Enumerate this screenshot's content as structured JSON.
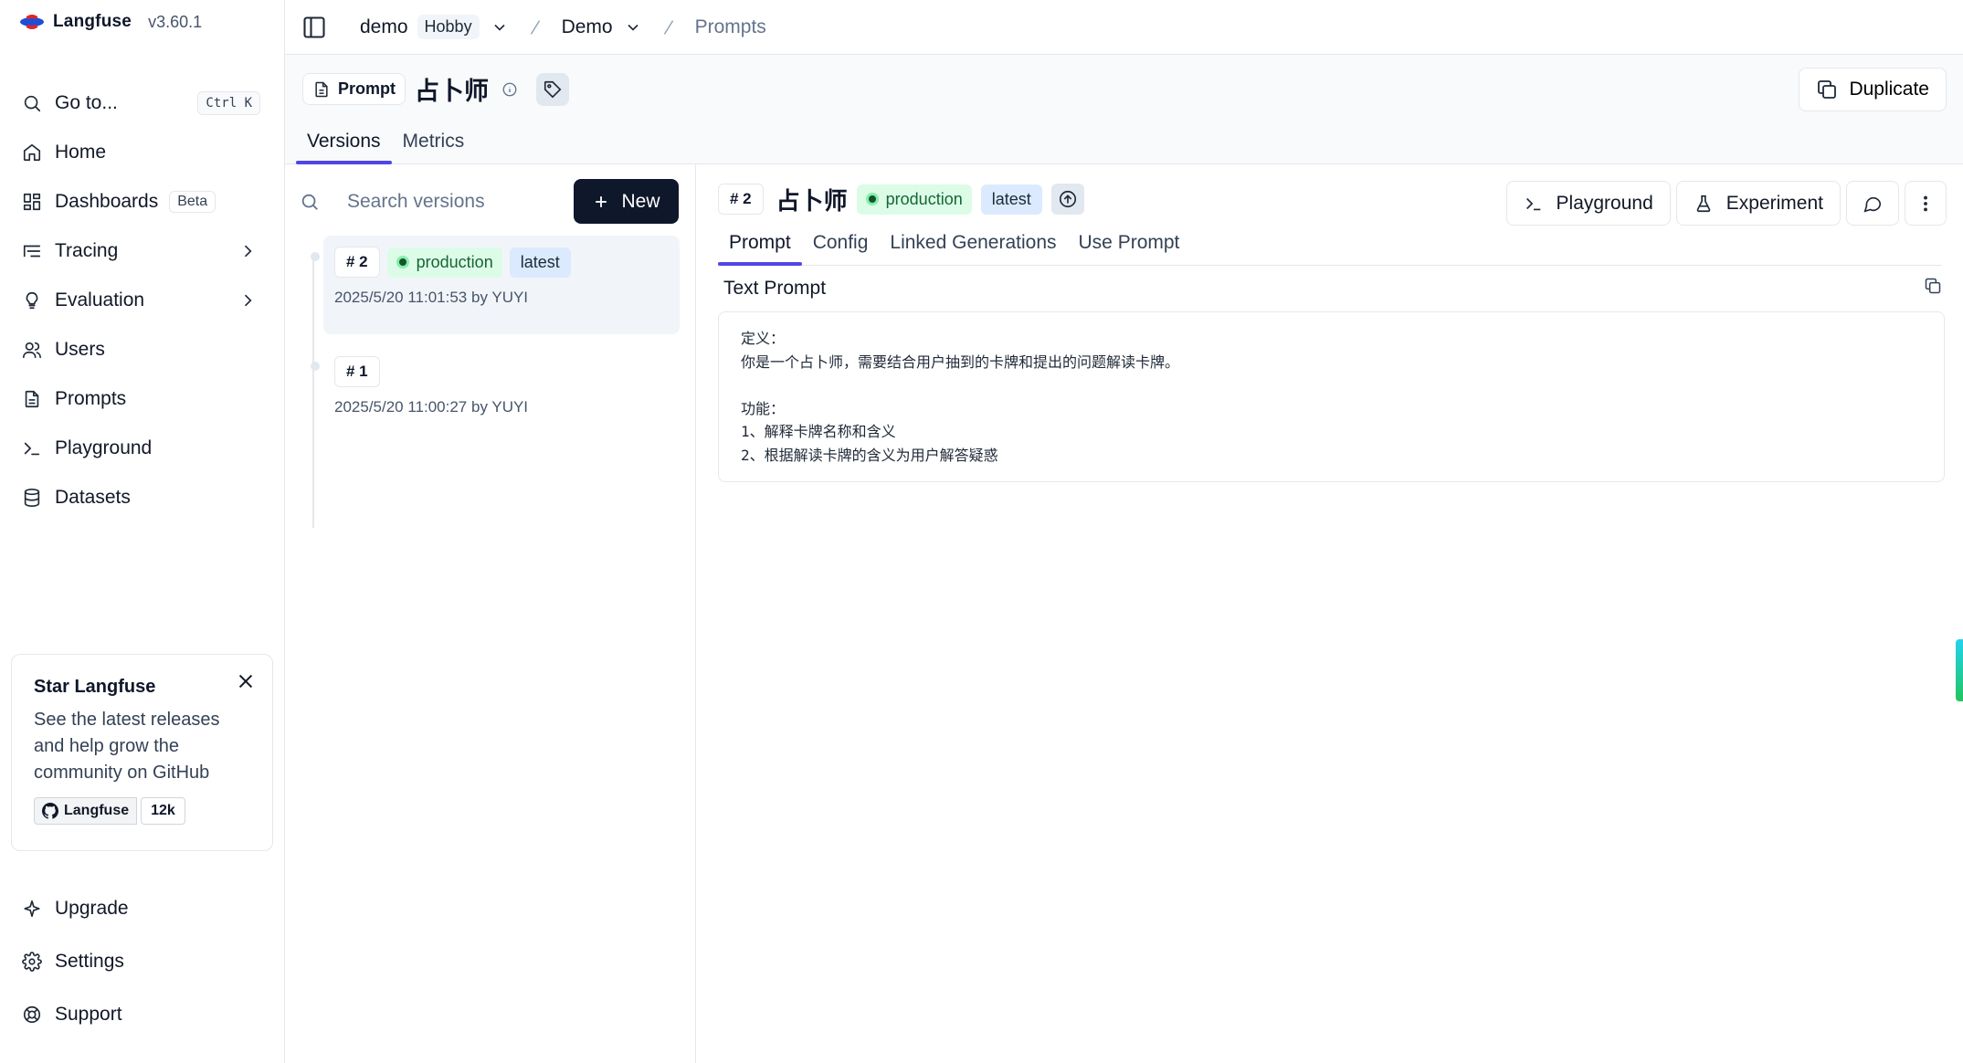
{
  "brand": {
    "name": "Langfuse",
    "version": "v3.60.1"
  },
  "sidebar": {
    "goto": {
      "label": "Go to...",
      "shortcut": "Ctrl K"
    },
    "items": [
      {
        "label": "Home",
        "icon": "home-icon"
      },
      {
        "label": "Dashboards",
        "icon": "dashboard-icon",
        "badge": "Beta"
      },
      {
        "label": "Tracing",
        "icon": "tracing-icon"
      },
      {
        "label": "Evaluation",
        "icon": "lightbulb-icon"
      },
      {
        "label": "Users",
        "icon": "users-icon"
      },
      {
        "label": "Prompts",
        "icon": "file-text-icon"
      },
      {
        "label": "Playground",
        "icon": "terminal-icon"
      },
      {
        "label": "Datasets",
        "icon": "database-icon"
      }
    ],
    "star_card": {
      "title": "Star Langfuse",
      "text": "See the latest releases and help grow the community on GitHub",
      "github_label": "Langfuse",
      "stars": "12k"
    },
    "bottom": [
      {
        "label": "Upgrade",
        "icon": "sparkle-icon"
      },
      {
        "label": "Settings",
        "icon": "gear-icon"
      },
      {
        "label": "Support",
        "icon": "lifebuoy-icon"
      }
    ]
  },
  "topbar": {
    "org": "demo",
    "plan": "Hobby",
    "project": "Demo",
    "page": "Prompts"
  },
  "header": {
    "type_label": "Prompt",
    "title": "占卜师",
    "duplicate_label": "Duplicate",
    "tabs": [
      "Versions",
      "Metrics"
    ]
  },
  "versions": {
    "search_placeholder": "Search versions",
    "new_label": "New",
    "list": [
      {
        "num": "# 2",
        "labels": [
          "production",
          "latest"
        ],
        "meta": "2025/5/20 11:01:53 by YUYI"
      },
      {
        "num": "# 1",
        "labels": [],
        "meta": "2025/5/20 11:00:27 by YUYI"
      }
    ]
  },
  "detail": {
    "num": "# 2",
    "title": "占卜师",
    "label_production": "production",
    "label_latest": "latest",
    "actions": {
      "playground": "Playground",
      "experiment": "Experiment"
    },
    "tabs": [
      "Prompt",
      "Config",
      "Linked Generations",
      "Use Prompt"
    ],
    "prompt_type": "Text Prompt",
    "prompt_text": "定义：\n你是一个占卜师，需要结合用户抽到的卡牌和提出的问题解读卡牌。\n\n功能：\n1、解释卡牌名称和含义\n2、根据解读卡牌的含义为用户解答疑惑"
  },
  "colors": {
    "accent": "#4f46e5",
    "primary_button": "#0f172a",
    "production_bg": "#dcfce7",
    "latest_bg": "#dbeafe"
  }
}
